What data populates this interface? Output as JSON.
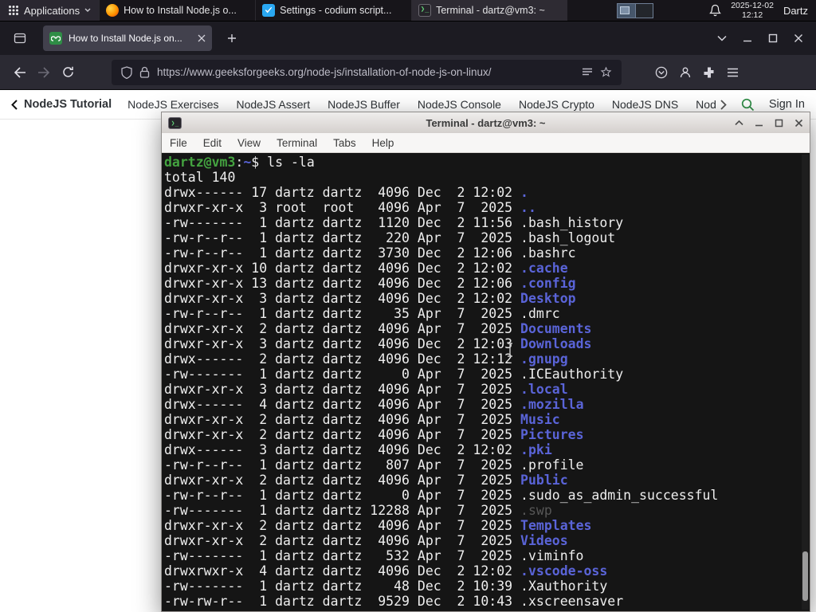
{
  "panel": {
    "applications_label": "Applications",
    "tasks": [
      {
        "label": "How to Install Node.js o...",
        "app": "firefox"
      },
      {
        "label": "Settings - codium script...",
        "app": "codium"
      },
      {
        "label": "Terminal - dartz@vm3: ~",
        "app": "terminal"
      }
    ],
    "clock_date": "2025-12-02",
    "clock_time": "12:12",
    "user": "Dartz"
  },
  "browser": {
    "tab_title": "How to Install Node.js on...",
    "url": "https://www.geeksforgeeks.org/node-js/installation-of-node-js-on-linux/"
  },
  "site_nav": {
    "back_item": "NodeJS Tutorial",
    "items": [
      "NodeJS Exercises",
      "NodeJS Assert",
      "NodeJS Buffer",
      "NodeJS Console",
      "NodeJS Crypto",
      "NodeJS DNS",
      "NodeJS"
    ],
    "sign_in": "Sign In",
    "accent_green": "#2f8d46"
  },
  "terminal": {
    "title": "Terminal - dartz@vm3: ~",
    "menu": [
      "File",
      "Edit",
      "View",
      "Terminal",
      "Tabs",
      "Help"
    ],
    "prompt_glyph": "❯_",
    "colors": {
      "background": "#151515",
      "foreground": "#eeeeee",
      "prompt_green": "#44a340",
      "directory_blue": "#5a64d8",
      "dim": "#565656"
    },
    "lines": [
      [
        {
          "c": "green",
          "t": "dartz@vm3"
        },
        {
          "c": "fg",
          "t": ":"
        },
        {
          "c": "blue",
          "t": "~"
        },
        {
          "c": "fg",
          "t": "$ ls -la"
        }
      ],
      [
        {
          "c": "fg",
          "t": "total 140"
        }
      ],
      [
        {
          "c": "fg",
          "t": "drwx------ 17 dartz dartz  4096 Dec  2 12:02 "
        },
        {
          "c": "blue",
          "t": "."
        }
      ],
      [
        {
          "c": "fg",
          "t": "drwxr-xr-x  3 root  root   4096 Apr  7  2025 "
        },
        {
          "c": "blue",
          "t": ".."
        }
      ],
      [
        {
          "c": "fg",
          "t": "-rw-------  1 dartz dartz  1120 Dec  2 11:56 .bash_history"
        }
      ],
      [
        {
          "c": "fg",
          "t": "-rw-r--r--  1 dartz dartz   220 Apr  7  2025 .bash_logout"
        }
      ],
      [
        {
          "c": "fg",
          "t": "-rw-r--r--  1 dartz dartz  3730 Dec  2 12:06 .bashrc"
        }
      ],
      [
        {
          "c": "fg",
          "t": "drwxr-xr-x 10 dartz dartz  4096 Dec  2 12:02 "
        },
        {
          "c": "blue",
          "t": ".cache"
        }
      ],
      [
        {
          "c": "fg",
          "t": "drwxr-xr-x 13 dartz dartz  4096 Dec  2 12:06 "
        },
        {
          "c": "blue",
          "t": ".config"
        }
      ],
      [
        {
          "c": "fg",
          "t": "drwxr-xr-x  3 dartz dartz  4096 Dec  2 12:02 "
        },
        {
          "c": "blue",
          "t": "Desktop"
        }
      ],
      [
        {
          "c": "fg",
          "t": "-rw-r--r--  1 dartz dartz    35 Apr  7  2025 .dmrc"
        }
      ],
      [
        {
          "c": "fg",
          "t": "drwxr-xr-x  2 dartz dartz  4096 Apr  7  2025 "
        },
        {
          "c": "blue",
          "t": "Documents"
        }
      ],
      [
        {
          "c": "fg",
          "t": "drwxr-xr-x  3 dartz dartz  4096 Dec  2 12:03 "
        },
        {
          "c": "blue",
          "t": "Downloads"
        }
      ],
      [
        {
          "c": "fg",
          "t": "drwx------  2 dartz dartz  4096 Dec  2 12:12 "
        },
        {
          "c": "blue",
          "t": ".gnupg"
        }
      ],
      [
        {
          "c": "fg",
          "t": "-rw-------  1 dartz dartz     0 Apr  7  2025 .ICEauthority"
        }
      ],
      [
        {
          "c": "fg",
          "t": "drwxr-xr-x  3 dartz dartz  4096 Apr  7  2025 "
        },
        {
          "c": "blue",
          "t": ".local"
        }
      ],
      [
        {
          "c": "fg",
          "t": "drwx------  4 dartz dartz  4096 Apr  7  2025 "
        },
        {
          "c": "blue",
          "t": ".mozilla"
        }
      ],
      [
        {
          "c": "fg",
          "t": "drwxr-xr-x  2 dartz dartz  4096 Apr  7  2025 "
        },
        {
          "c": "blue",
          "t": "Music"
        }
      ],
      [
        {
          "c": "fg",
          "t": "drwxr-xr-x  2 dartz dartz  4096 Apr  7  2025 "
        },
        {
          "c": "blue",
          "t": "Pictures"
        }
      ],
      [
        {
          "c": "fg",
          "t": "drwx------  3 dartz dartz  4096 Dec  2 12:02 "
        },
        {
          "c": "blue",
          "t": ".pki"
        }
      ],
      [
        {
          "c": "fg",
          "t": "-rw-r--r--  1 dartz dartz   807 Apr  7  2025 .profile"
        }
      ],
      [
        {
          "c": "fg",
          "t": "drwxr-xr-x  2 dartz dartz  4096 Apr  7  2025 "
        },
        {
          "c": "blue",
          "t": "Public"
        }
      ],
      [
        {
          "c": "fg",
          "t": "-rw-r--r--  1 dartz dartz     0 Apr  7  2025 .sudo_as_admin_successful"
        }
      ],
      [
        {
          "c": "fg",
          "t": "-rw-------  1 dartz dartz 12288 Apr  7  2025 "
        },
        {
          "c": "dim",
          "t": ".swp"
        }
      ],
      [
        {
          "c": "fg",
          "t": "drwxr-xr-x  2 dartz dartz  4096 Apr  7  2025 "
        },
        {
          "c": "blue",
          "t": "Templates"
        }
      ],
      [
        {
          "c": "fg",
          "t": "drwxr-xr-x  2 dartz dartz  4096 Apr  7  2025 "
        },
        {
          "c": "blue",
          "t": "Videos"
        }
      ],
      [
        {
          "c": "fg",
          "t": "-rw-------  1 dartz dartz   532 Apr  7  2025 .viminfo"
        }
      ],
      [
        {
          "c": "fg",
          "t": "drwxrwxr-x  4 dartz dartz  4096 Dec  2 12:02 "
        },
        {
          "c": "blue",
          "t": ".vscode-oss"
        }
      ],
      [
        {
          "c": "fg",
          "t": "-rw-------  1 dartz dartz    48 Dec  2 10:39 .Xauthority"
        }
      ],
      [
        {
          "c": "fg",
          "t": "-rw-rw-r--  1 dartz dartz  9529 Dec  2 10:43 .xscreensaver"
        }
      ]
    ]
  }
}
